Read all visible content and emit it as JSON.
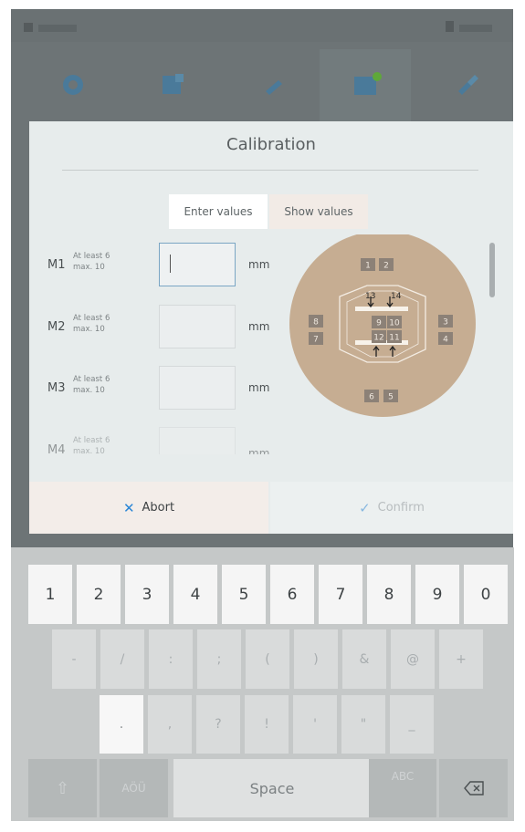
{
  "dialog": {
    "title": "Calibration",
    "tabs": {
      "enter": "Enter values",
      "show": "Show values"
    },
    "rows": [
      {
        "label": "M1",
        "hint_line1": "At least 6",
        "hint_line2": "max. 10",
        "value": "",
        "unit": "mm"
      },
      {
        "label": "M2",
        "hint_line1": "At least 6",
        "hint_line2": "max. 10",
        "value": "",
        "unit": "mm"
      },
      {
        "label": "M3",
        "hint_line1": "At least 6",
        "hint_line2": "max. 10",
        "value": "",
        "unit": "mm"
      },
      {
        "label": "M4",
        "hint_line1": "At least 6",
        "hint_line2": "max. 10",
        "value": "",
        "unit": "mm"
      }
    ],
    "diagram": {
      "colors": {
        "disc": "#c6ad92",
        "box": "#8c8177",
        "box_text": "#efe7de"
      },
      "points": {
        "p1": "1",
        "p2": "2",
        "p3": "3",
        "p4": "4",
        "p5": "5",
        "p6": "6",
        "p7": "7",
        "p8": "8",
        "p9": "9",
        "p10": "10",
        "p11": "11",
        "p12": "12",
        "p13": "13",
        "p14": "14"
      }
    },
    "buttons": {
      "abort": "Abort",
      "confirm": "Confirm"
    }
  },
  "keyboard": {
    "row1": [
      "1",
      "2",
      "3",
      "4",
      "5",
      "6",
      "7",
      "8",
      "9",
      "0"
    ],
    "row2": [
      "-",
      "/",
      ":",
      ";",
      "(",
      ")",
      "&",
      "@",
      "+"
    ],
    "row3": [
      ".",
      ",",
      "?",
      "!",
      "'",
      "\"",
      "_"
    ],
    "abc_label": "AÖÜ",
    "abc_label2": "ABC",
    "space_label": "Space"
  }
}
